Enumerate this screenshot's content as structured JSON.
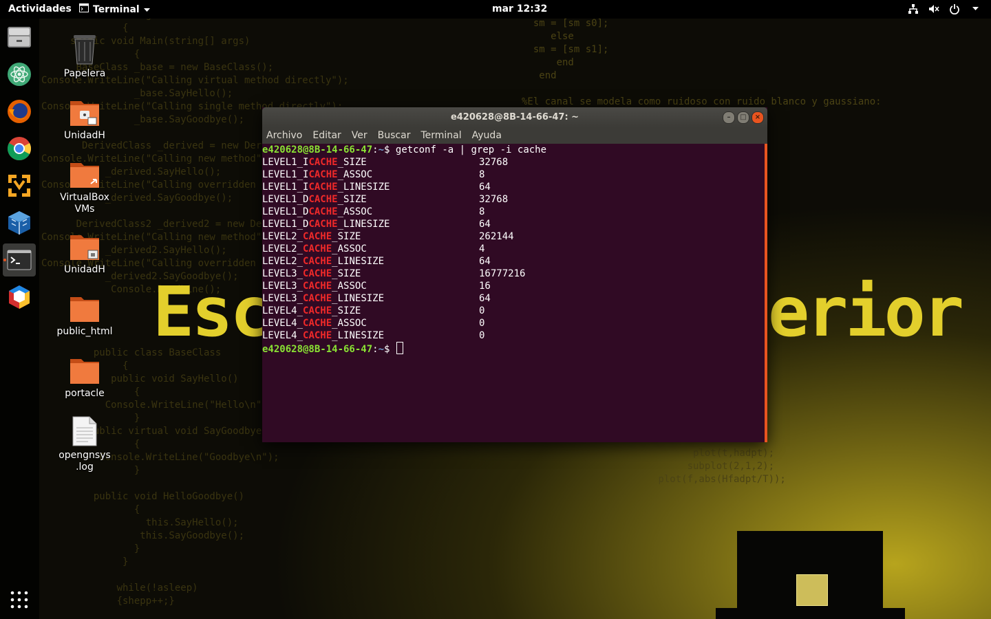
{
  "topbar": {
    "activities": "Actividades",
    "app_name": "Terminal",
    "clock": "mar 12:32"
  },
  "desktop": {
    "icons": [
      {
        "label": "Papelera"
      },
      {
        "label": "UnidadH"
      },
      {
        "label": "VirtualBox VMs"
      },
      {
        "label": "UnidadH"
      },
      {
        "label": "public_html"
      },
      {
        "label": "portacle"
      },
      {
        "label": "opengnsys.log"
      }
    ]
  },
  "dock": {
    "apps": [
      "files",
      "atom",
      "firefox",
      "chrome",
      "vmware",
      "virtualbox",
      "terminal",
      "sketchup"
    ]
  },
  "wallpaper": {
    "code_left": "                {\n         class Program\n              {\n     static void Main(string[] args)\n                {\n      BaseClass _base = new BaseClass();\nConsole.WriteLine(\"Calling virtual method directly\");\n                _base.SayHello();\nConsole.WriteLine(\"Calling single method directly\");\n                _base.SayGoodbye();\n\n       DerivedClass _derived = new DerivedClass();\nConsole.WriteLine(\"Calling new method\");\n           _derived.SayHello();\nConsole.WriteLine(\"Calling overridden method\");\n           _derived.SayGoodbye();\n\n      DerivedClass2 _derived2 = new DerivedClass2();\nConsole.WriteLine(\"Calling new method\");\n           _derived2.SayHello();\nConsole.WriteLine(\"Calling overridden method\");\n           _derived2.SayGoodbye();\n            Console.ReadLine();\n",
    "code_left_bottom": "         public class BaseClass\n              {\n            public void SayHello()\n                {\n           Console.WriteLine(\"Hello\\n\");\n                }\n        public virtual void SayGoodbye()\n                {\n          Console.WriteLine(\"Goodbye\\n\");\n                }\n\n         public void HelloGoodbye()\n                {\n                  this.SayHello();\n                 this.SayGoodbye();\n                }\n              }\n\n             while(!asleep)\n             {shepp++;}",
    "code_right": "if sec(n)==0\n  sm = [sm s0];\n     else\n  sm = [sm s1];\n      end\n   end\n\n%El canal se modela como ruidoso con ruido blanco y gaussiano:\n                  sm,2),eta,Fs);\n\n                   (rt));\n\n                  O:\n\n                  t);\n                  N-Ns)];\n                 t(hadpt));\n\n                  al:\n\n                  shift(Zf));",
    "code_right_bottom": "                 ;\n                 ));\n                 ;\n\n                 ;\n                 ));\n\n\n       plot(t,hadpt);\n      subplot(2,1,2);\n plot(f,abs(Hfadpt/T));",
    "banner_left": "Escu",
    "banner_right": "erior"
  },
  "terminal": {
    "title": "e420628@8B-14-66-47: ~",
    "menu": [
      "Archivo",
      "Editar",
      "Ver",
      "Buscar",
      "Terminal",
      "Ayuda"
    ],
    "prompt_user": "e420628@8B-14-66-47",
    "prompt_path": "~",
    "command": "getconf -a | grep -i cache",
    "highlight": "CACHE",
    "rows": [
      {
        "pre": "LEVEL1_I",
        "post": "_SIZE",
        "value": "32768"
      },
      {
        "pre": "LEVEL1_I",
        "post": "_ASSOC",
        "value": "8"
      },
      {
        "pre": "LEVEL1_I",
        "post": "_LINESIZE",
        "value": "64"
      },
      {
        "pre": "LEVEL1_D",
        "post": "_SIZE",
        "value": "32768"
      },
      {
        "pre": "LEVEL1_D",
        "post": "_ASSOC",
        "value": "8"
      },
      {
        "pre": "LEVEL1_D",
        "post": "_LINESIZE",
        "value": "64"
      },
      {
        "pre": "LEVEL2_",
        "post": "_SIZE",
        "value": "262144"
      },
      {
        "pre": "LEVEL2_",
        "post": "_ASSOC",
        "value": "4"
      },
      {
        "pre": "LEVEL2_",
        "post": "_LINESIZE",
        "value": "64"
      },
      {
        "pre": "LEVEL3_",
        "post": "_SIZE",
        "value": "16777216"
      },
      {
        "pre": "LEVEL3_",
        "post": "_ASSOC",
        "value": "16"
      },
      {
        "pre": "LEVEL3_",
        "post": "_LINESIZE",
        "value": "64"
      },
      {
        "pre": "LEVEL4_",
        "post": "_SIZE",
        "value": "0"
      },
      {
        "pre": "LEVEL4_",
        "post": "_ASSOC",
        "value": "0"
      },
      {
        "pre": "LEVEL4_",
        "post": "_LINESIZE",
        "value": "0"
      }
    ]
  },
  "colors": {
    "terminal_bg": "#300a24",
    "prompt_green": "#8ae234",
    "prompt_blue": "#729fcf",
    "grep_highlight": "#ef2929",
    "ubuntu_orange": "#e95420"
  }
}
